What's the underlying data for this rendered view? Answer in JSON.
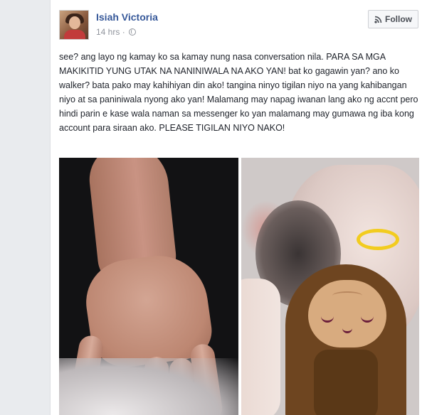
{
  "post": {
    "author": "Isiah Victoria",
    "time": "14 hrs",
    "separator": "·",
    "follow_label": "Follow",
    "text": "see? ang layo ng kamay ko sa kamay nung nasa conversation nila. PARA SA MGA MAKIKITID YUNG UTAK NA NANINIWALA NA AKO YAN! bat ko gagawin yan? ano ko walker? bata pako may kahihiyan din ako! tangina ninyo tigilan niyo na yang kahibangan niyo at sa paniniwala nyong ako yan! Malamang may napag iwanan lang ako ng accnt pero hindi parin e kase wala naman sa messenger ko yan malamang may gumawa ng iba kong account para siraan ako. PLEASE TIGILAN NIYO NAKO!"
  },
  "icons": {
    "follow": "rss-icon",
    "privacy": "globe-icon"
  },
  "colors": {
    "name_link": "#365899",
    "meta_text": "#90949c",
    "background": "#e9ebee",
    "halo": "#f2cc1f",
    "nail_polish": "#c7142e"
  }
}
